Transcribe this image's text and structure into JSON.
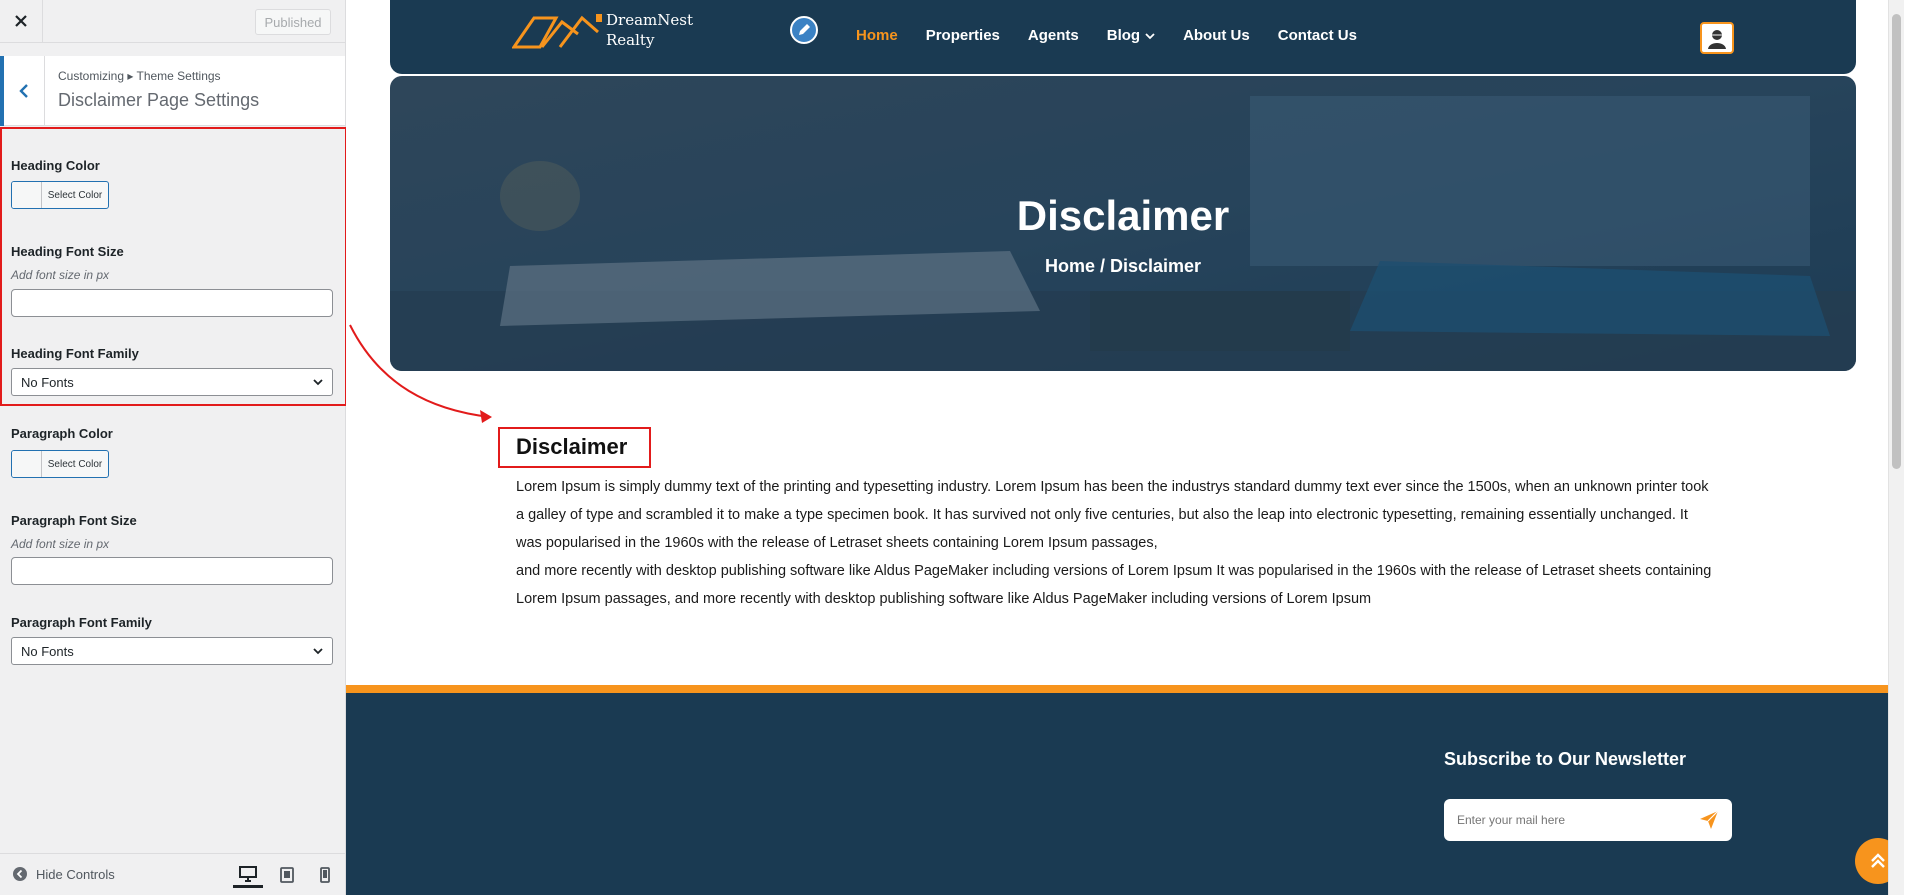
{
  "sidebar": {
    "close_icon": "close-icon",
    "publish_label": "Published",
    "breadcrumb": "Customizing ▸ Theme Settings",
    "section_title": "Disclaimer Page Settings",
    "heading_color": {
      "label": "Heading Color",
      "button": "Select Color"
    },
    "heading_font_size": {
      "label": "Heading Font Size",
      "description": "Add font size in px",
      "value": ""
    },
    "heading_font_family": {
      "label": "Heading Font Family",
      "selected": "No Fonts"
    },
    "paragraph_color": {
      "label": "Paragraph Color",
      "button": "Select Color"
    },
    "paragraph_font_size": {
      "label": "Paragraph Font Size",
      "description": "Add font size in px",
      "value": ""
    },
    "paragraph_font_family": {
      "label": "Paragraph Font Family",
      "selected": "No Fonts"
    },
    "hide_controls": "Hide Controls",
    "annotation_color": "#e21b1b"
  },
  "site": {
    "brand": {
      "line1": "DreamNest",
      "line2": "Realty"
    },
    "nav": [
      "Home",
      "Properties",
      "Agents",
      "Blog",
      "About Us",
      "Contact Us"
    ],
    "hero": {
      "title": "Disclaimer",
      "breadcrumb": "Home / Disclaimer"
    },
    "content": {
      "heading": "Disclaimer",
      "paragraph1": "Lorem Ipsum is simply dummy text of the printing and typesetting industry. Lorem Ipsum has been the industrys standard dummy text ever since the 1500s, when an unknown printer took a galley of type and scrambled it to make a type specimen book. It has survived not only five centuries, but also the leap into electronic typesetting, remaining essentially unchanged. It was popularised in the 1960s with the release of Letraset sheets containing Lorem Ipsum passages,",
      "paragraph2": "and more recently with desktop publishing software like Aldus PageMaker including versions of Lorem Ipsum It was popularised in the 1960s with the release of Letraset sheets containing Lorem Ipsum passages, and more recently with desktop publishing software like Aldus PageMaker including versions of Lorem Ipsum"
    },
    "newsletter": {
      "title": "Subscribe to Our Newsletter",
      "placeholder": "Enter your mail here"
    },
    "colors": {
      "navy": "#1a3a52",
      "accent": "#f7941d"
    }
  }
}
